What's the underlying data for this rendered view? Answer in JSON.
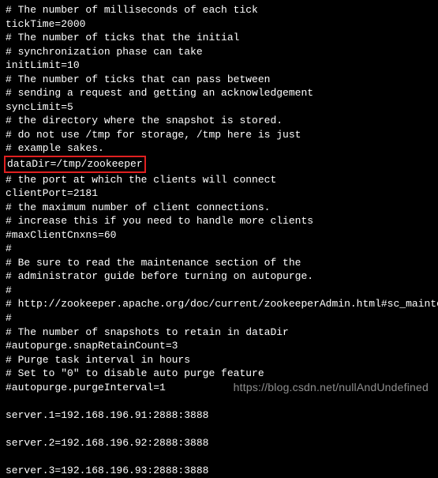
{
  "config": {
    "lines": [
      "# The number of milliseconds of each tick",
      "tickTime=2000",
      "# The number of ticks that the initial",
      "# synchronization phase can take",
      "initLimit=10",
      "# The number of ticks that can pass between",
      "# sending a request and getting an acknowledgement",
      "syncLimit=5",
      "# the directory where the snapshot is stored.",
      "# do not use /tmp for storage, /tmp here is just",
      "# example sakes.",
      "dataDir=/tmp/zookeeper",
      "# the port at which the clients will connect",
      "clientPort=2181",
      "# the maximum number of client connections.",
      "# increase this if you need to handle more clients",
      "#maxClientCnxns=60",
      "#",
      "# Be sure to read the maintenance section of the",
      "# administrator guide before turning on autopurge.",
      "#",
      "# http://zookeeper.apache.org/doc/current/zookeeperAdmin.html#sc_maintenance",
      "#",
      "# The number of snapshots to retain in dataDir",
      "#autopurge.snapRetainCount=3",
      "# Purge task interval in hours",
      "# Set to \"0\" to disable auto purge feature",
      "#autopurge.purgeInterval=1",
      "",
      "server.1=192.168.196.91:2888:3888",
      "",
      "server.2=192.168.196.92:2888:3888",
      "",
      "server.3=192.168.196.93:2888:3888"
    ],
    "highlight_index": 11
  },
  "watermark": "https://blog.csdn.net/nullAndUndefined"
}
